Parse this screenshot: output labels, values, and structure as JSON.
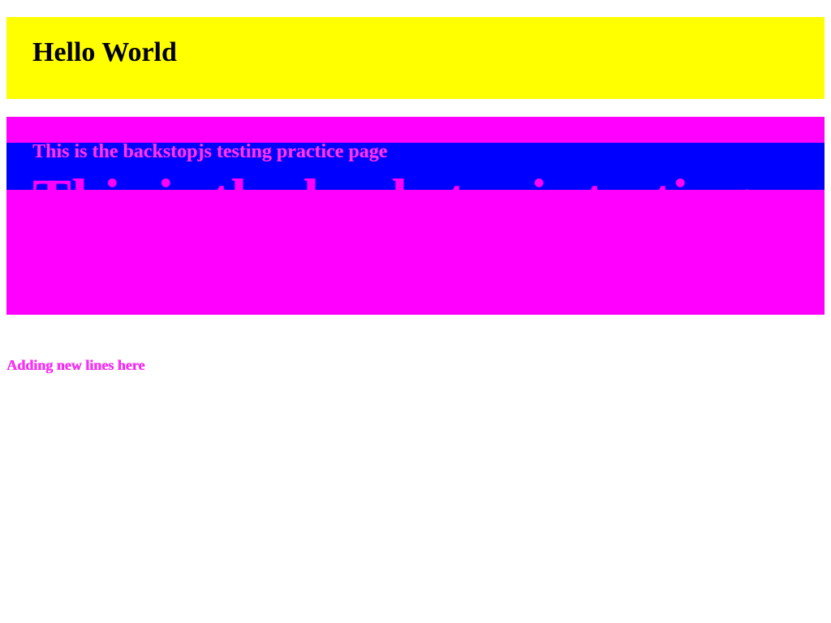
{
  "hero": {
    "title": "Hello World"
  },
  "practice_section": {
    "subtitle": "This is the backstopjs testing practice page",
    "large_text": "This is the backstopjs testing practice page"
  },
  "new_lines": {
    "text": "Adding new lines here"
  },
  "colors": {
    "hero_background": "#ffff00",
    "panel_background": "#ff00ff",
    "band_background": "#0000ff",
    "heading_text": "#000000",
    "accent_text": "#ff33ff"
  }
}
